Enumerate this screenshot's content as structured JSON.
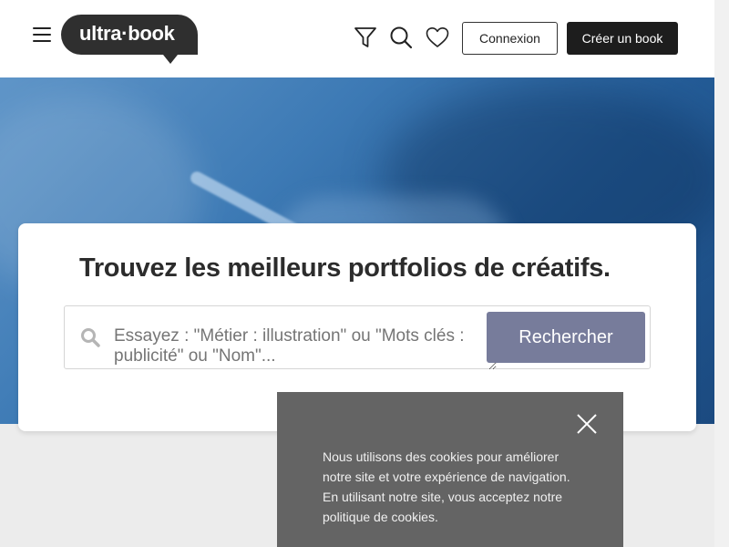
{
  "header": {
    "logo_text": "ultra·book",
    "login_label": "Connexion",
    "create_label": "Créer un book",
    "icons": [
      "menu-icon",
      "filter-icon",
      "search-icon",
      "heart-icon"
    ]
  },
  "search": {
    "title": "Trouvez les meilleurs portfolios de créatifs.",
    "placeholder": "Essayez : \"Métier : illustration\" ou \"Mots clés : publicité\" ou \"Nom\"...",
    "button_label": "Rechercher"
  },
  "cookie": {
    "text": "Nous utilisons des cookies pour améliorer notre site et votre expérience de navigation. En utilisant notre site, vous acceptez notre politique de cookies."
  },
  "colors": {
    "header_bg": "#ffffff",
    "dark_button": "#1d1d1d",
    "search_button": "#777c9b",
    "cookie_bg": "#646464",
    "hero_blue": "#245c97"
  }
}
